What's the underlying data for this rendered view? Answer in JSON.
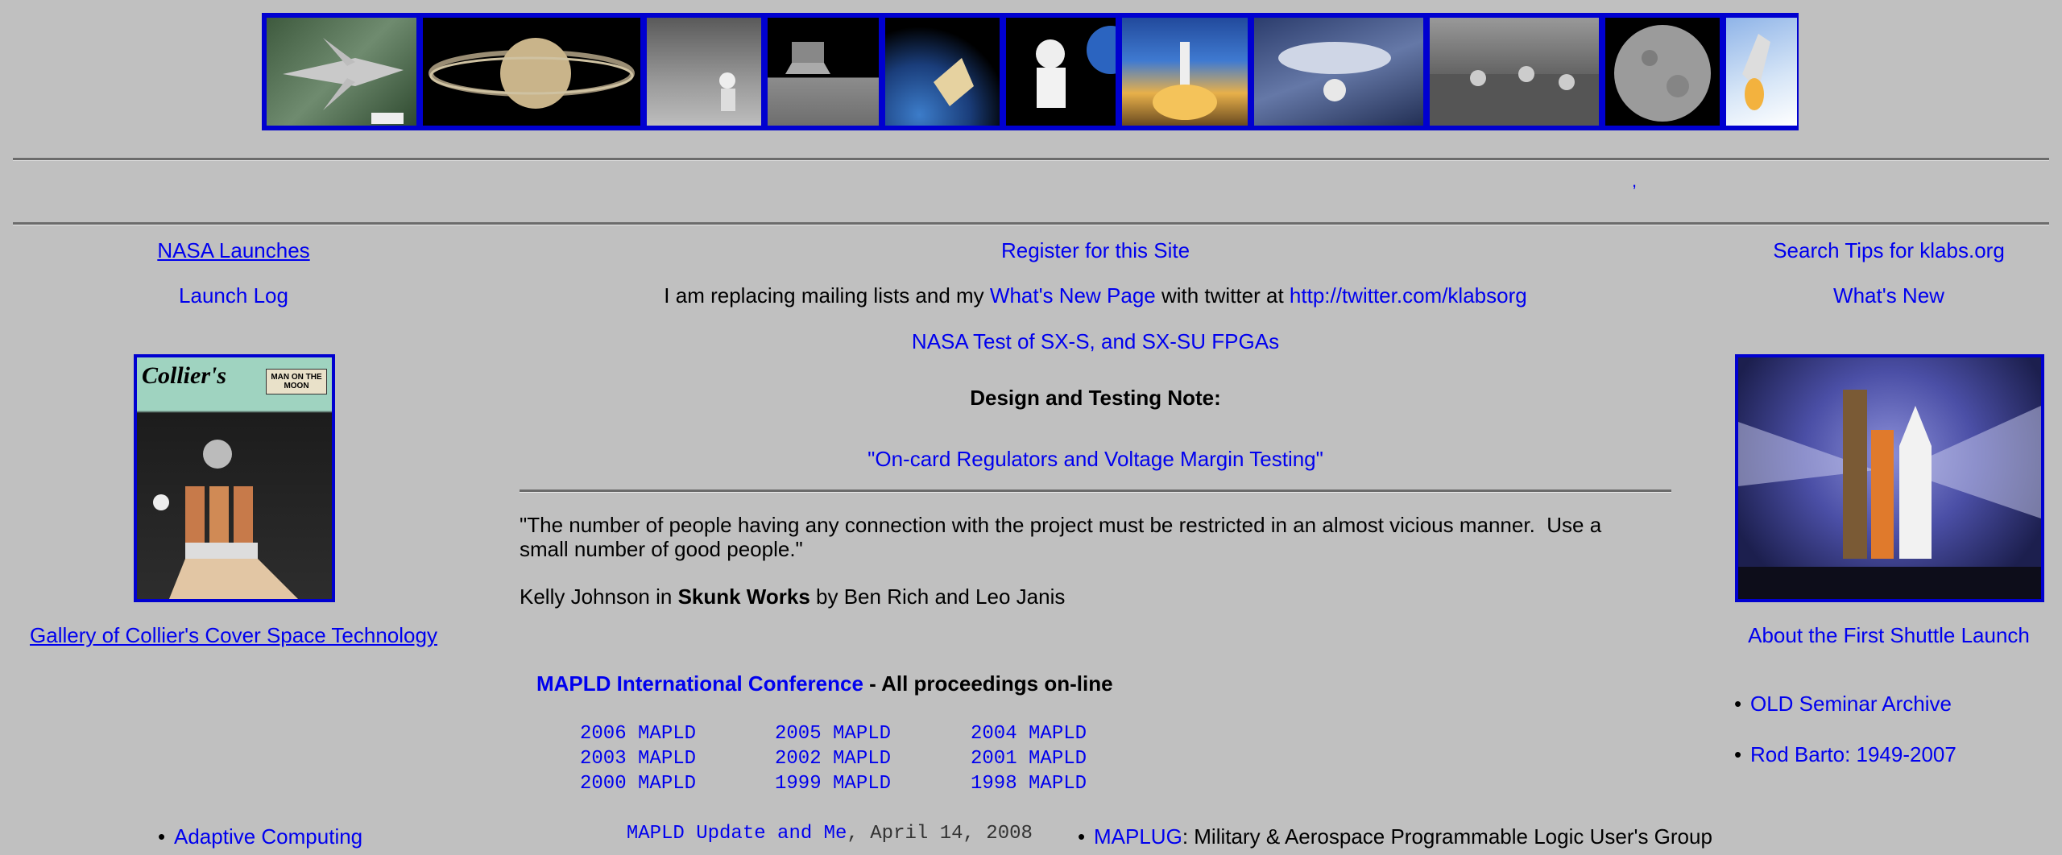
{
  "strip": {
    "thumbs": [
      "shuttle-top-thumb",
      "saturn-thumb",
      "lunar-surface-thumb",
      "lunar-module-thumb",
      "earth-capsule-thumb",
      "astronaut-thumb",
      "launch-thumb",
      "shuttle-bay-thumb",
      "mission-control-thumb",
      "moon-thumb",
      "shuttle-launch-thumb"
    ]
  },
  "divider_tick": ",",
  "left": {
    "nasa_launches": "NASA Launches",
    "launch_log": "Launch Log",
    "colliers_logo": "Collier's",
    "colliers_badge": "MAN ON THE MOON",
    "gallery_link": "Gallery of Collier's Cover Space Technology",
    "adaptive": "Adaptive Computing"
  },
  "center": {
    "register": "Register for this Site",
    "twitter_prefix": "I am replacing mailing lists and my ",
    "whats_new_page": "What's New Page",
    "twitter_middle": " with twitter at ",
    "twitter_url": "http://twitter.com/klabsorg",
    "nasa_test": "NASA Test of SX-S, and SX-SU FPGAs",
    "design_note": "Design and Testing Note:",
    "regulators": "\"On-card Regulators and Voltage Margin Testing\"",
    "quote": "\"The number of people having any connection with the project must be restricted in an almost vicious manner.  Use a small number of good people.\"",
    "attrib_prefix": "Kelly Johnson in ",
    "attrib_book": "Skunk Works",
    "attrib_suffix": " by Ben Rich and Leo Janis",
    "mapld_link": "MAPLD International Conference",
    "mapld_suffix": " - All proceedings on-line",
    "mapld_years": [
      [
        "2006 MAPLD",
        "2005 MAPLD",
        "2004 MAPLD"
      ],
      [
        "2003 MAPLD",
        "2002 MAPLD",
        "2001 MAPLD"
      ],
      [
        "2000 MAPLD",
        "1999 MAPLD",
        "1998 MAPLD"
      ]
    ],
    "update_link": "MAPLD Update and Me",
    "update_date": ", April 14, 2008",
    "maplug_link": "MAPLUG",
    "maplug_desc": ":  Military & Aerospace Programmable Logic User's Group"
  },
  "right": {
    "search_tips": "Search Tips for klabs.org",
    "whats_new": "What's New",
    "first_shuttle": "About the First Shuttle Launch",
    "old_seminar": "OLD Seminar Archive",
    "rod_barto": "Rod Barto: 1949-2007"
  }
}
